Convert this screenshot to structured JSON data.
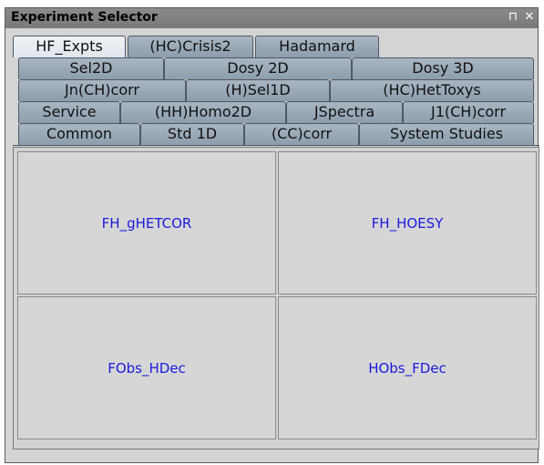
{
  "window": {
    "title": "Experiment Selector",
    "float_icon": "float-icon",
    "close_icon": "close-icon",
    "float_glyph": "⊓",
    "close_glyph": "✕"
  },
  "tabs": {
    "row5": [
      "HF_Expts",
      "(HC)Crisis2",
      "Hadamard"
    ],
    "row4": [
      "Sel2D",
      "Dosy 2D",
      "Dosy 3D"
    ],
    "row3": [
      "Jn(CH)corr",
      "(H)Sel1D",
      "(HC)HetToxys"
    ],
    "row2": [
      "Service",
      "(HH)Homo2D",
      "JSpectra",
      "J1(CH)corr"
    ],
    "row1": [
      "Common",
      "Std 1D",
      "(CC)corr",
      "System Studies"
    ],
    "selected": "HF_Expts"
  },
  "experiments": [
    {
      "label": "FH_gHETCOR"
    },
    {
      "label": "FH_HOESY"
    },
    {
      "label": "FObs_HDec"
    },
    {
      "label": "HObs_FDec"
    }
  ],
  "colors": {
    "tab": "#9aa8b6",
    "tab_selected": "#e6ecf1",
    "link_text": "#1a1add"
  }
}
